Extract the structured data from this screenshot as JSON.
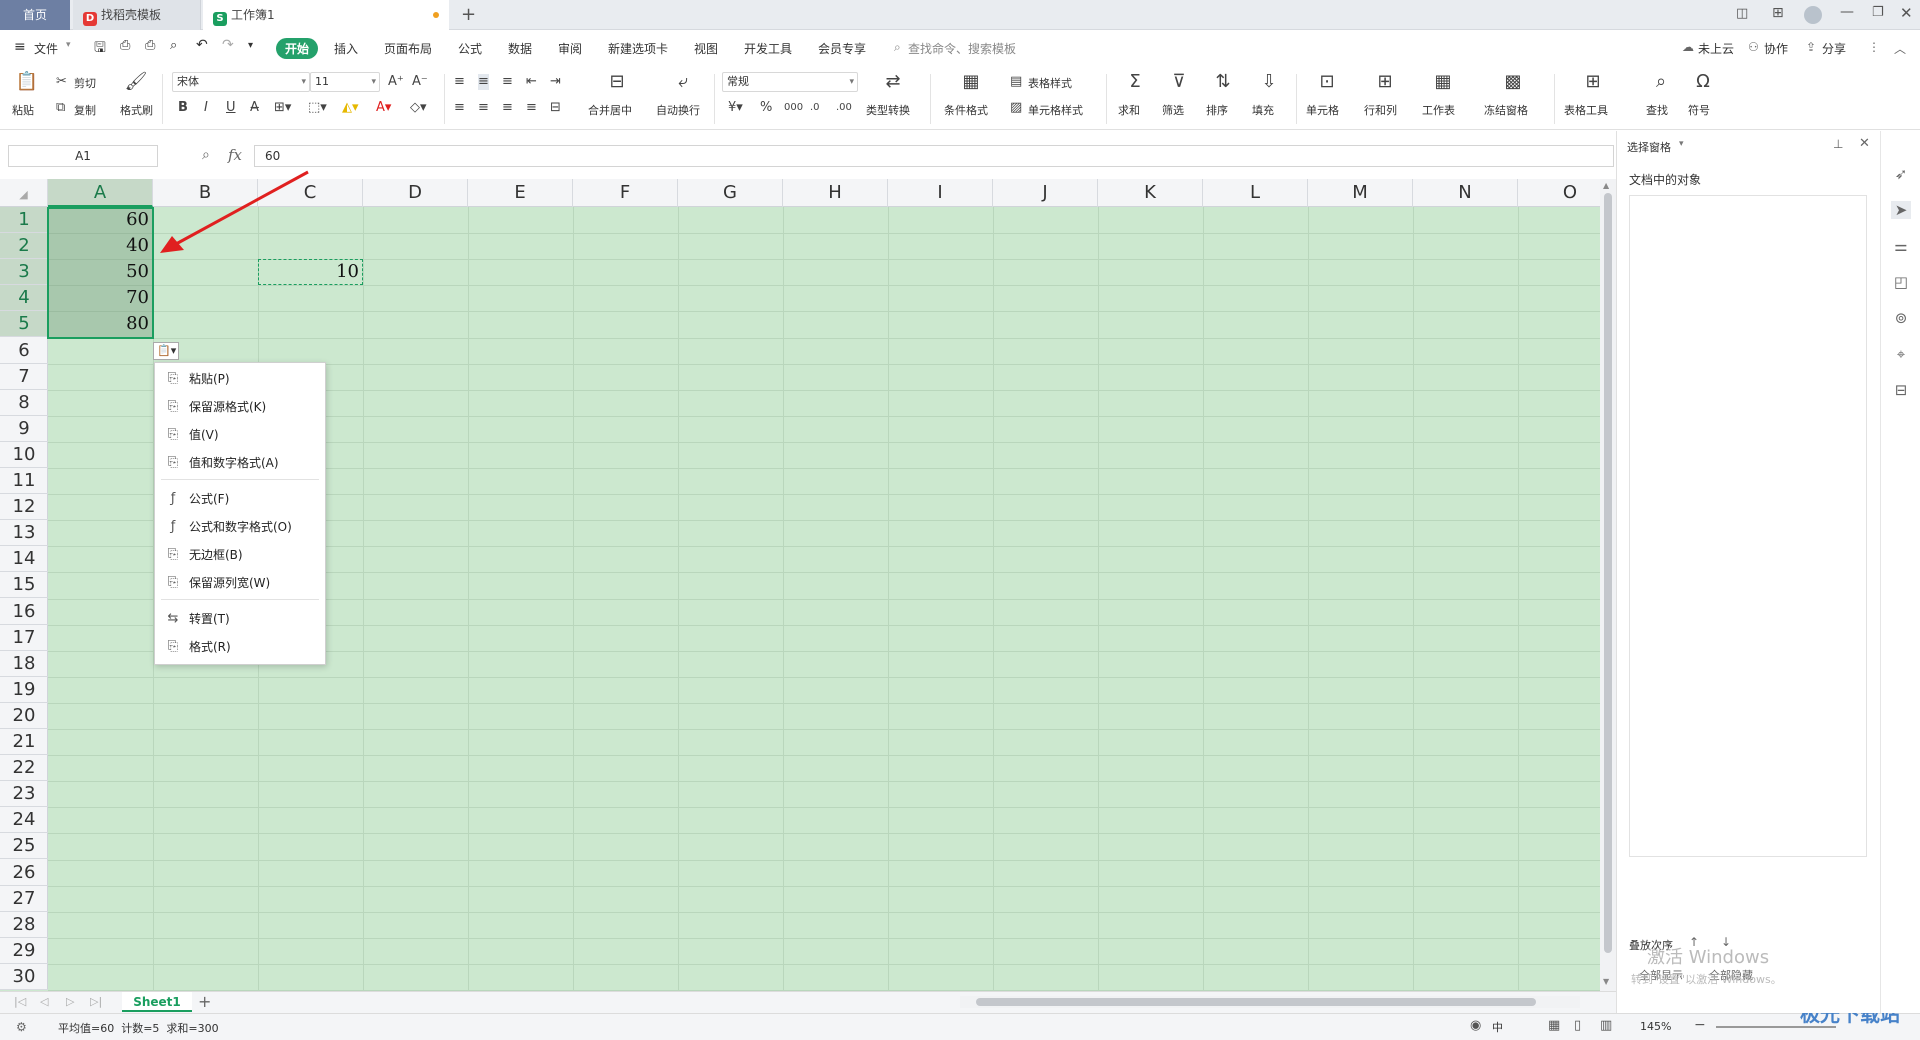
{
  "tabs": [
    {
      "label": "首页"
    },
    {
      "label": "找稻壳模板"
    },
    {
      "label": "工作簿1"
    }
  ],
  "new_tab": "+",
  "menu": {
    "file": "文件",
    "items": [
      "开始",
      "插入",
      "页面布局",
      "公式",
      "数据",
      "审阅",
      "新建选项卡",
      "视图",
      "开发工具",
      "会员专享"
    ],
    "search_placeholder": "查找命令、搜索模板",
    "right": [
      "未上云",
      "协作",
      "分享"
    ]
  },
  "ribbon": {
    "paste": "粘贴",
    "cut": "剪切",
    "copy": "复制",
    "format_painter": "格式刷",
    "font": "宋体",
    "font_size": "11",
    "merge": "合并居中",
    "wrap": "自动换行",
    "number_format": "常规",
    "type_convert": "类型转换",
    "cond_format": "条件格式",
    "table_style": "表格样式",
    "cell_style": "单元格样式",
    "sum": "求和",
    "filter": "筛选",
    "sort": "排序",
    "fill": "填充",
    "cell": "单元格",
    "rowcol": "行和列",
    "sheet": "工作表",
    "freeze": "冻结窗格",
    "table_tools": "表格工具",
    "find": "查找",
    "symbol": "符号"
  },
  "formula_bar": {
    "name_box": "A1",
    "fx": "fx",
    "value": "60"
  },
  "grid": {
    "columns": [
      "A",
      "B",
      "C",
      "D",
      "E",
      "F",
      "G",
      "H",
      "I",
      "J",
      "K",
      "L",
      "M",
      "N",
      "O"
    ],
    "rows": [
      "1",
      "2",
      "3",
      "4",
      "5",
      "6",
      "7",
      "8",
      "9",
      "10",
      "11",
      "12",
      "13",
      "14",
      "15",
      "16",
      "17",
      "18",
      "19",
      "20",
      "21",
      "22",
      "23",
      "24",
      "25",
      "26",
      "27",
      "28",
      "29",
      "30"
    ],
    "a_values": [
      "60",
      "40",
      "50",
      "70",
      "80"
    ],
    "c3_value": "10"
  },
  "context_menu": [
    {
      "label": "粘贴(P)",
      "icon": "paste-icon"
    },
    {
      "label": "保留源格式(K)",
      "icon": "keep-format-icon"
    },
    {
      "label": "值(V)",
      "icon": "values-icon"
    },
    {
      "label": "值和数字格式(A)",
      "icon": "values-number-icon"
    },
    {
      "label": "公式(F)",
      "icon": "formula-icon"
    },
    {
      "label": "公式和数字格式(O)",
      "icon": "formula-number-icon"
    },
    {
      "label": "无边框(B)",
      "icon": "no-border-icon"
    },
    {
      "label": "保留源列宽(W)",
      "icon": "keep-width-icon"
    },
    {
      "label": "转置(T)",
      "icon": "transpose-icon"
    },
    {
      "label": "格式(R)",
      "icon": "format-icon"
    }
  ],
  "sheet_tab": "Sheet1",
  "status": {
    "summary": "平均值=60  计数=5  求和=300",
    "zoom": "145%",
    "input_mode": "中"
  },
  "right_panel": {
    "title": "选择窗格",
    "objects_label": "文档中的对象",
    "stack_order": "叠放次序",
    "show_all": "全部显示",
    "hide_all": "全部隐藏",
    "watermark_title": "激活 Windows",
    "watermark_sub": "转到\"设置\"以激活 Windows。"
  },
  "brand_watermark": "极光下载站",
  "colors": {
    "accent": "#1a9e5f",
    "grid_bg": "#cce8cf",
    "arrow": "#e02020"
  }
}
